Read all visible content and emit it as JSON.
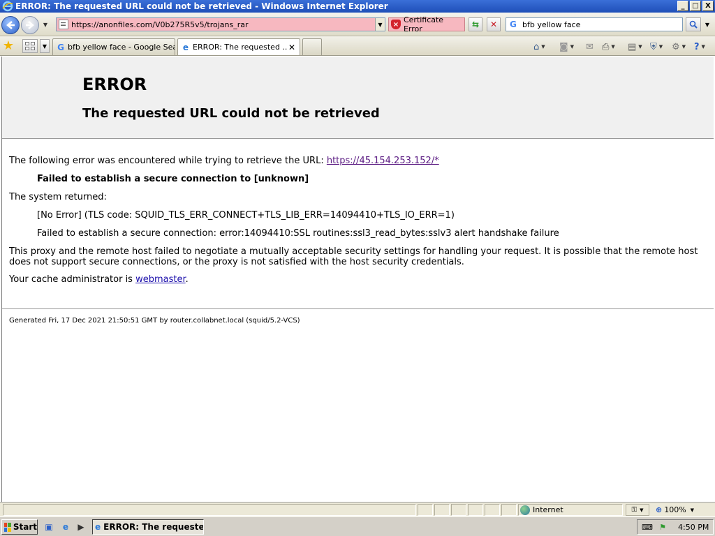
{
  "window": {
    "title": "ERROR: The requested URL could not be retrieved - Windows Internet Explorer",
    "minimize": "_",
    "maximize": "□",
    "close": "X"
  },
  "addressbar": {
    "url": "https://anonfiles.com/V0b275R5v5/trojans_rar",
    "cert_error": "Certificate Error",
    "search_value": "bfb yellow face"
  },
  "tabs": [
    {
      "label": "bfb yellow face - Google Sea...",
      "icon": "google-g-icon",
      "active": false
    },
    {
      "label": "ERROR: The requested ...",
      "icon": "ie-page-icon",
      "active": true
    }
  ],
  "page": {
    "heading": "ERROR",
    "subheading": "The requested URL could not be retrieved",
    "intro_text": "The following error was encountered while trying to retrieve the URL: ",
    "intro_link": "https://45.154.253.152/*",
    "failure": "Failed to establish a secure connection to [unknown]",
    "system_returned": "The system returned:",
    "tls_code": "[No Error] (TLS code: SQUID_TLS_ERR_CONNECT+TLS_LIB_ERR=14094410+TLS_IO_ERR=1)",
    "ssl_error": "Failed to establish a secure connection: error:14094410:SSL routines:ssl3_read_bytes:sslv3 alert handshake failure",
    "explanation": "This proxy and the remote host failed to negotiate a mutually acceptable security settings for handling your request. It is possible that the remote host does not support secure connections, or the proxy is not satisfied with the host security credentials.",
    "admin_prefix": "Your cache administrator is ",
    "admin_link": "webmaster",
    "admin_suffix": ".",
    "footer": "Generated Fri, 17 Dec 2021 21:50:51 GMT by router.collabnet.local (squid/5.2-VCS)"
  },
  "statusbar": {
    "zone": "Internet",
    "zoom": "100%"
  },
  "taskbar": {
    "start": "Start",
    "task_label": "ERROR: The requeste...",
    "clock": "4:50 PM"
  },
  "colors": {
    "address_error_bg": "#f7b8c0",
    "visited_link": "#5a1a82",
    "link": "#1a0dab",
    "titlebar": "#2a5cc8"
  }
}
